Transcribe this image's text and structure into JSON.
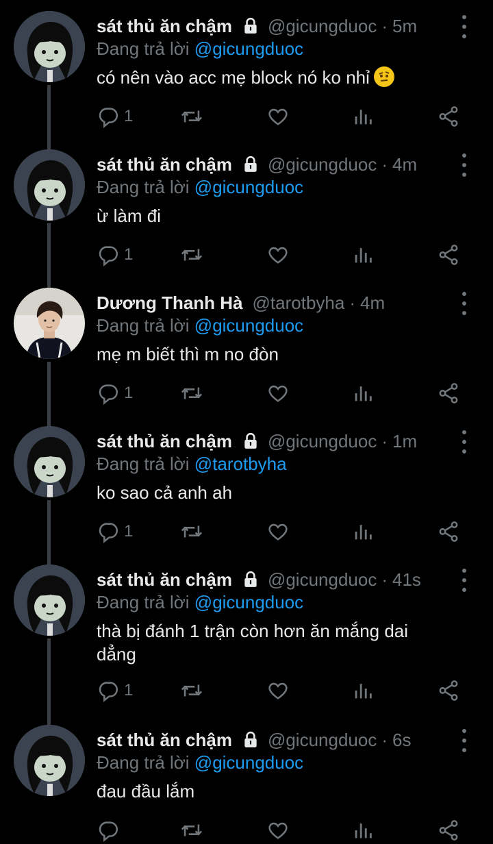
{
  "tweets": [
    {
      "name": "sát thủ ăn chậm",
      "locked": true,
      "handle": "@gicungduoc",
      "time": "5m",
      "replying_prefix": "Đang trả lời",
      "replying_to": "@gicungduoc",
      "text": "có nên vào acc mẹ block nó ko nhỉ",
      "emoji": "raised-eyebrow-face",
      "reply_count": "1",
      "avatar": "cartoon"
    },
    {
      "name": "sát thủ ăn chậm",
      "locked": true,
      "handle": "@gicungduoc",
      "time": "4m",
      "replying_prefix": "Đang trả lời",
      "replying_to": "@gicungduoc",
      "text": "ừ làm đi",
      "reply_count": "1",
      "avatar": "cartoon"
    },
    {
      "name": "Dương Thanh Hà",
      "locked": false,
      "handle": "@tarotbyha",
      "time": "4m",
      "replying_prefix": "Đang trả lời",
      "replying_to": "@gicungduoc",
      "text": "mẹ m biết thì m no đòn",
      "reply_count": "1",
      "avatar": "photo"
    },
    {
      "name": "sát thủ ăn chậm",
      "locked": true,
      "handle": "@gicungduoc",
      "time": "1m",
      "replying_prefix": "Đang trả lời",
      "replying_to": "@tarotbyha",
      "text": "ko sao cả anh ah",
      "reply_count": "1",
      "avatar": "cartoon"
    },
    {
      "name": "sát thủ ăn chậm",
      "locked": true,
      "handle": "@gicungduoc",
      "time": "41s",
      "replying_prefix": "Đang trả lời",
      "replying_to": "@gicungduoc",
      "text": "thà bị đánh 1 trận còn hơn ăn mắng dai dẳng",
      "reply_count": "1",
      "avatar": "cartoon"
    },
    {
      "name": "sát thủ ăn chậm",
      "locked": true,
      "handle": "@gicungduoc",
      "time": "6s",
      "replying_prefix": "Đang trả lời",
      "replying_to": "@gicungduoc",
      "text": "đau đầu lắm",
      "reply_count": "",
      "avatar": "cartoon"
    }
  ],
  "icons": {
    "reply": "reply-icon",
    "retweet": "retweet-icon",
    "like": "like-icon",
    "analytics": "analytics-icon",
    "share": "share-icon",
    "lock": "lock-icon",
    "more": "more-icon"
  },
  "colors": {
    "background": "#000000",
    "text": "#e7e9ea",
    "secondary": "#71767b",
    "link": "#1d9bf0"
  }
}
